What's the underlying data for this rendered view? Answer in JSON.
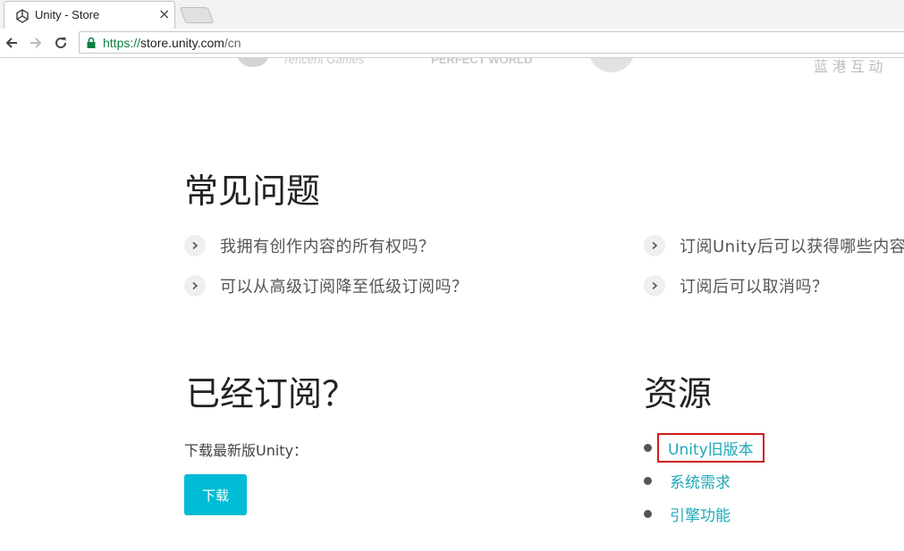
{
  "browser": {
    "tab_title": "Unity - Store",
    "tab_close": "×",
    "url_scheme": "https://",
    "url_host": "store.unity.com",
    "url_path": "/cn"
  },
  "logos": {
    "tencent": "Tencent Games",
    "perfect_world": "PERFECT WORLD",
    "lantern": "蓝 港 互 动"
  },
  "faq": {
    "title": "常见问题",
    "items": [
      "我拥有创作内容的所有权吗？",
      "订阅Unity后可以获得哪些内容",
      "可以从高级订阅降至低级订阅吗？",
      "订阅后可以取消吗？"
    ]
  },
  "subscribed": {
    "title": "已经订阅？",
    "lead": "下载最新版Unity：",
    "button": "下载"
  },
  "resources": {
    "title": "资源",
    "links": [
      "Unity旧版本",
      "系统需求",
      "引擎功能"
    ]
  },
  "colors": {
    "accent": "#00bcd4",
    "link": "#1fa8b8",
    "highlight_box": "#d11a1a"
  }
}
